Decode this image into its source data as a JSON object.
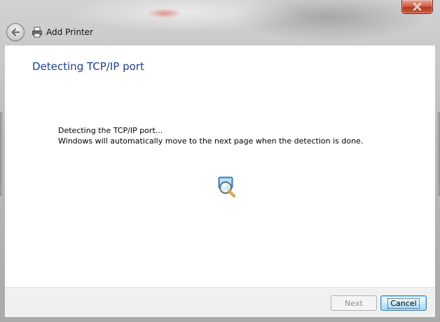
{
  "window": {
    "title": "Add Printer"
  },
  "titlebar": {
    "close_icon": "close-x-icon"
  },
  "header": {
    "back_icon": "back-arrow-icon",
    "printer_icon": "printer-icon"
  },
  "page": {
    "heading": "Detecting TCP/IP port",
    "message_line1": "Detecting the TCP/IP port...",
    "message_line2": "Windows will automatically move to the next page when the detection is done.",
    "status_icon": "searching-magnifier-icon"
  },
  "footer": {
    "next_label": "Next",
    "cancel_label": "Cancel"
  },
  "colors": {
    "heading": "#1e3f8a",
    "close_button": "#c8462c",
    "footer_bg": "#f0f0f0"
  }
}
